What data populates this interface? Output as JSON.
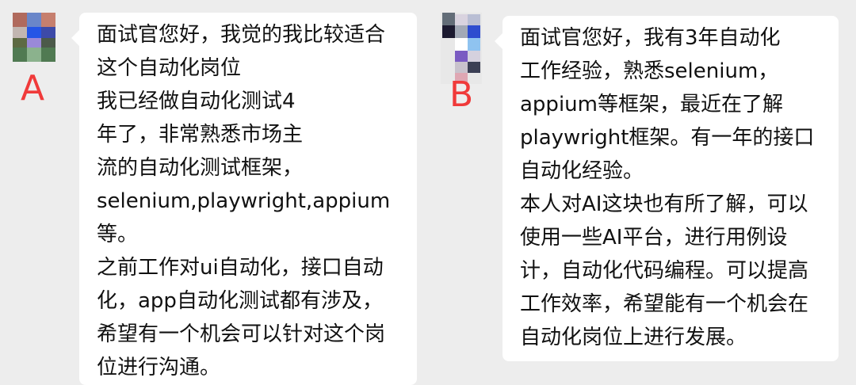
{
  "messages": [
    {
      "sender_label": "A",
      "lines": [
        "面试官您好，我觉的我比较适合",
        "这个自动化岗位",
        "我已经做自动化测试4",
        "年了，非常熟悉市场主",
        "流的自动化测试框架，",
        "selenium,playwright,appium",
        "等。",
        "之前工作对ui自动化，接口自动",
        "化，app自动化测试都有涉及，",
        "希望有一个机会可以针对这个岗",
        "位进行沟通。"
      ]
    },
    {
      "sender_label": "B",
      "lines": [
        "面试官您好，我有3年自动化",
        "工作经验，熟悉selenium，",
        "appium等框架，最近在了解",
        "playwright框架。有一年的接口",
        "自动化经验。",
        "本人对AI这块也有所了解，可以",
        "使用一些AI平台，进行用例设",
        "计，自动化代码编程。可以提高",
        "工作效率，希望能有一个机会在",
        "自动化岗位上进行发展。"
      ]
    }
  ],
  "colors": {
    "background": "#ededed",
    "bubble": "#ffffff",
    "label": "#f03a3a",
    "text": "#111111"
  },
  "icons": {
    "avatar_a": "avatar-a-icon",
    "avatar_b": "avatar-b-icon"
  }
}
